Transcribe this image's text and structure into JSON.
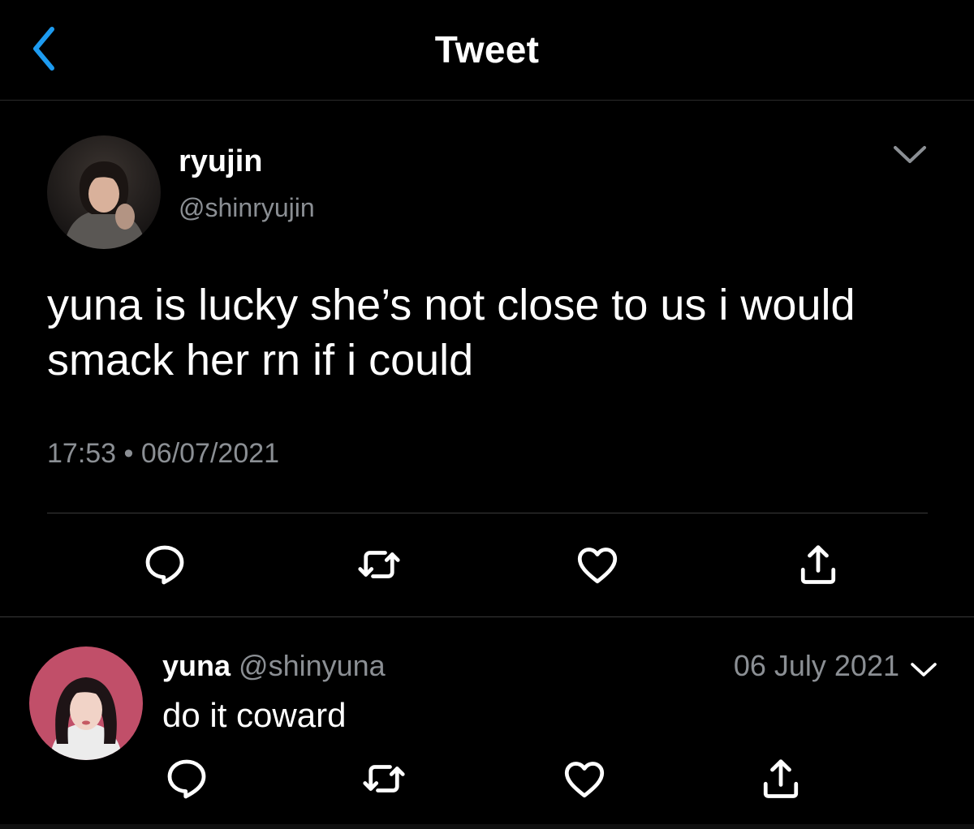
{
  "header": {
    "title": "Tweet",
    "back_icon": "chevron-left-icon",
    "accent_color": "#1d9bf0"
  },
  "tweet": {
    "author_name": "ryujin",
    "author_handle": "@shinryujin",
    "text": "yuna is lucky she’s not close to us i would smack her rn if i could",
    "timestamp": "17:53 • 06/07/2021",
    "menu_icon": "chevron-down-icon",
    "actions": [
      "reply-icon",
      "retweet-icon",
      "like-icon",
      "share-icon"
    ]
  },
  "reply": {
    "author_name": "yuna",
    "author_handle": "@shinyuna",
    "date": "06 July 2021",
    "text": "do it coward",
    "menu_icon": "chevron-down-icon",
    "actions": [
      "reply-icon",
      "retweet-icon",
      "like-icon",
      "share-icon"
    ]
  },
  "colors": {
    "background": "#000000",
    "secondary_text": "#8b8f94",
    "divider": "#3a3a3a"
  }
}
